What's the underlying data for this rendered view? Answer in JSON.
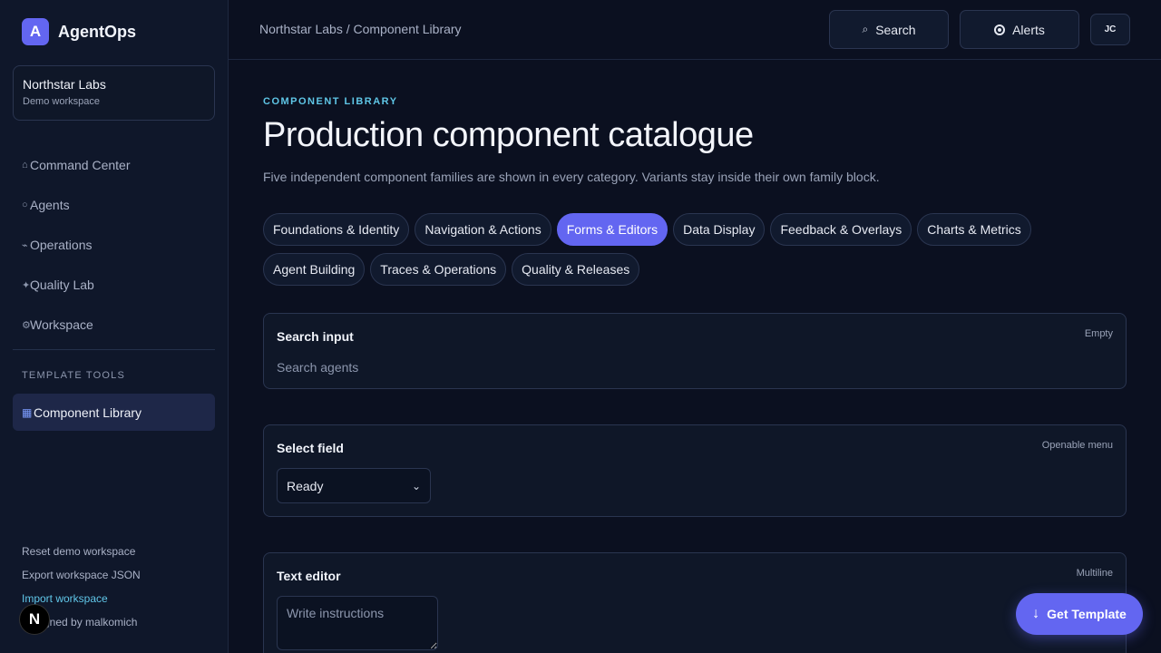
{
  "brand": {
    "logo_letter": "A",
    "name": "AgentOps"
  },
  "workspace": {
    "name": "Northstar Labs",
    "subtitle": "Demo workspace"
  },
  "nav": {
    "items": [
      {
        "label": "Command Center",
        "icon": "⌂",
        "icon_name": "home-icon"
      },
      {
        "label": "Agents",
        "icon": "○",
        "icon_name": "circle-icon"
      },
      {
        "label": "Operations",
        "icon": "⌁",
        "icon_name": "pulse-icon"
      },
      {
        "label": "Quality Lab",
        "icon": "✦",
        "icon_name": "sparkle-icon"
      },
      {
        "label": "Workspace",
        "icon": "⚙",
        "icon_name": "gear-icon"
      }
    ],
    "section_label": "TEMPLATE TOOLS",
    "active_item": {
      "label": "Component Library",
      "icon": "▦",
      "icon_name": "grid-icon"
    }
  },
  "footer_links": {
    "reset": "Reset demo workspace",
    "export": "Export workspace JSON",
    "import": "Import workspace",
    "credit": "Designed by malkomich"
  },
  "n_badge": "N",
  "topbar": {
    "breadcrumb": "Northstar Labs / Component Library",
    "search_label": "Search",
    "alerts_label": "Alerts",
    "user_initials": "JC"
  },
  "page": {
    "eyebrow": "COMPONENT LIBRARY",
    "title": "Production component catalogue",
    "subtitle": "Five independent component families are shown in every category. Variants stay inside their own family block."
  },
  "tabs": [
    {
      "label": "Foundations & Identity",
      "active": false
    },
    {
      "label": "Navigation & Actions",
      "active": false
    },
    {
      "label": "Forms & Editors",
      "active": true
    },
    {
      "label": "Data Display",
      "active": false
    },
    {
      "label": "Feedback & Overlays",
      "active": false
    },
    {
      "label": "Charts & Metrics",
      "active": false
    },
    {
      "label": "Agent Building",
      "active": false
    },
    {
      "label": "Traces & Operations",
      "active": false
    },
    {
      "label": "Quality & Releases",
      "active": false
    }
  ],
  "cards": {
    "search": {
      "title": "Search input",
      "meta": "Empty",
      "placeholder": "Search agents"
    },
    "select": {
      "title": "Select field",
      "meta": "Openable menu",
      "value": "Ready"
    },
    "editor": {
      "title": "Text editor",
      "meta": "Multiline",
      "placeholder": "Write instructions"
    }
  },
  "fab": {
    "label": "Get Template",
    "icon": "↓"
  },
  "colors": {
    "accent": "#6366f1",
    "eyebrow": "#5fc6e6",
    "link": "#60c6e8",
    "background": "#0b1020"
  }
}
